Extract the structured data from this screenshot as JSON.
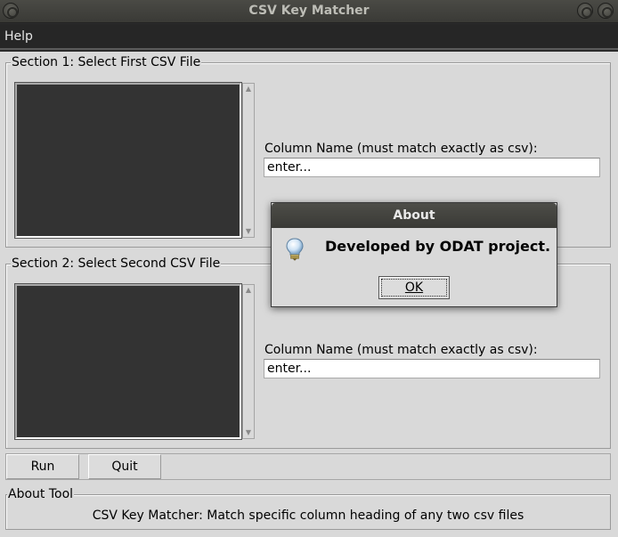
{
  "window": {
    "title": "CSV Key Matcher"
  },
  "menubar": {
    "help_label": "Help"
  },
  "section1": {
    "title": "Section 1: Select First CSV File",
    "column_label": "Column Name (must match exactly as csv):",
    "column_value": "enter..."
  },
  "section2": {
    "title": "Section 2: Select Second CSV File",
    "column_label": "Column Name (must match exactly as csv):",
    "column_value": "enter..."
  },
  "buttons": {
    "run_label": "Run",
    "quit_label": "Quit"
  },
  "about_tool": {
    "title": "About Tool",
    "text": "CSV Key Matcher: Match specific column heading of any two csv files"
  },
  "dialog": {
    "title": "About",
    "message": "Developed by ODAT project.",
    "icon": "lightbulb-icon",
    "ok_label": "OK"
  }
}
